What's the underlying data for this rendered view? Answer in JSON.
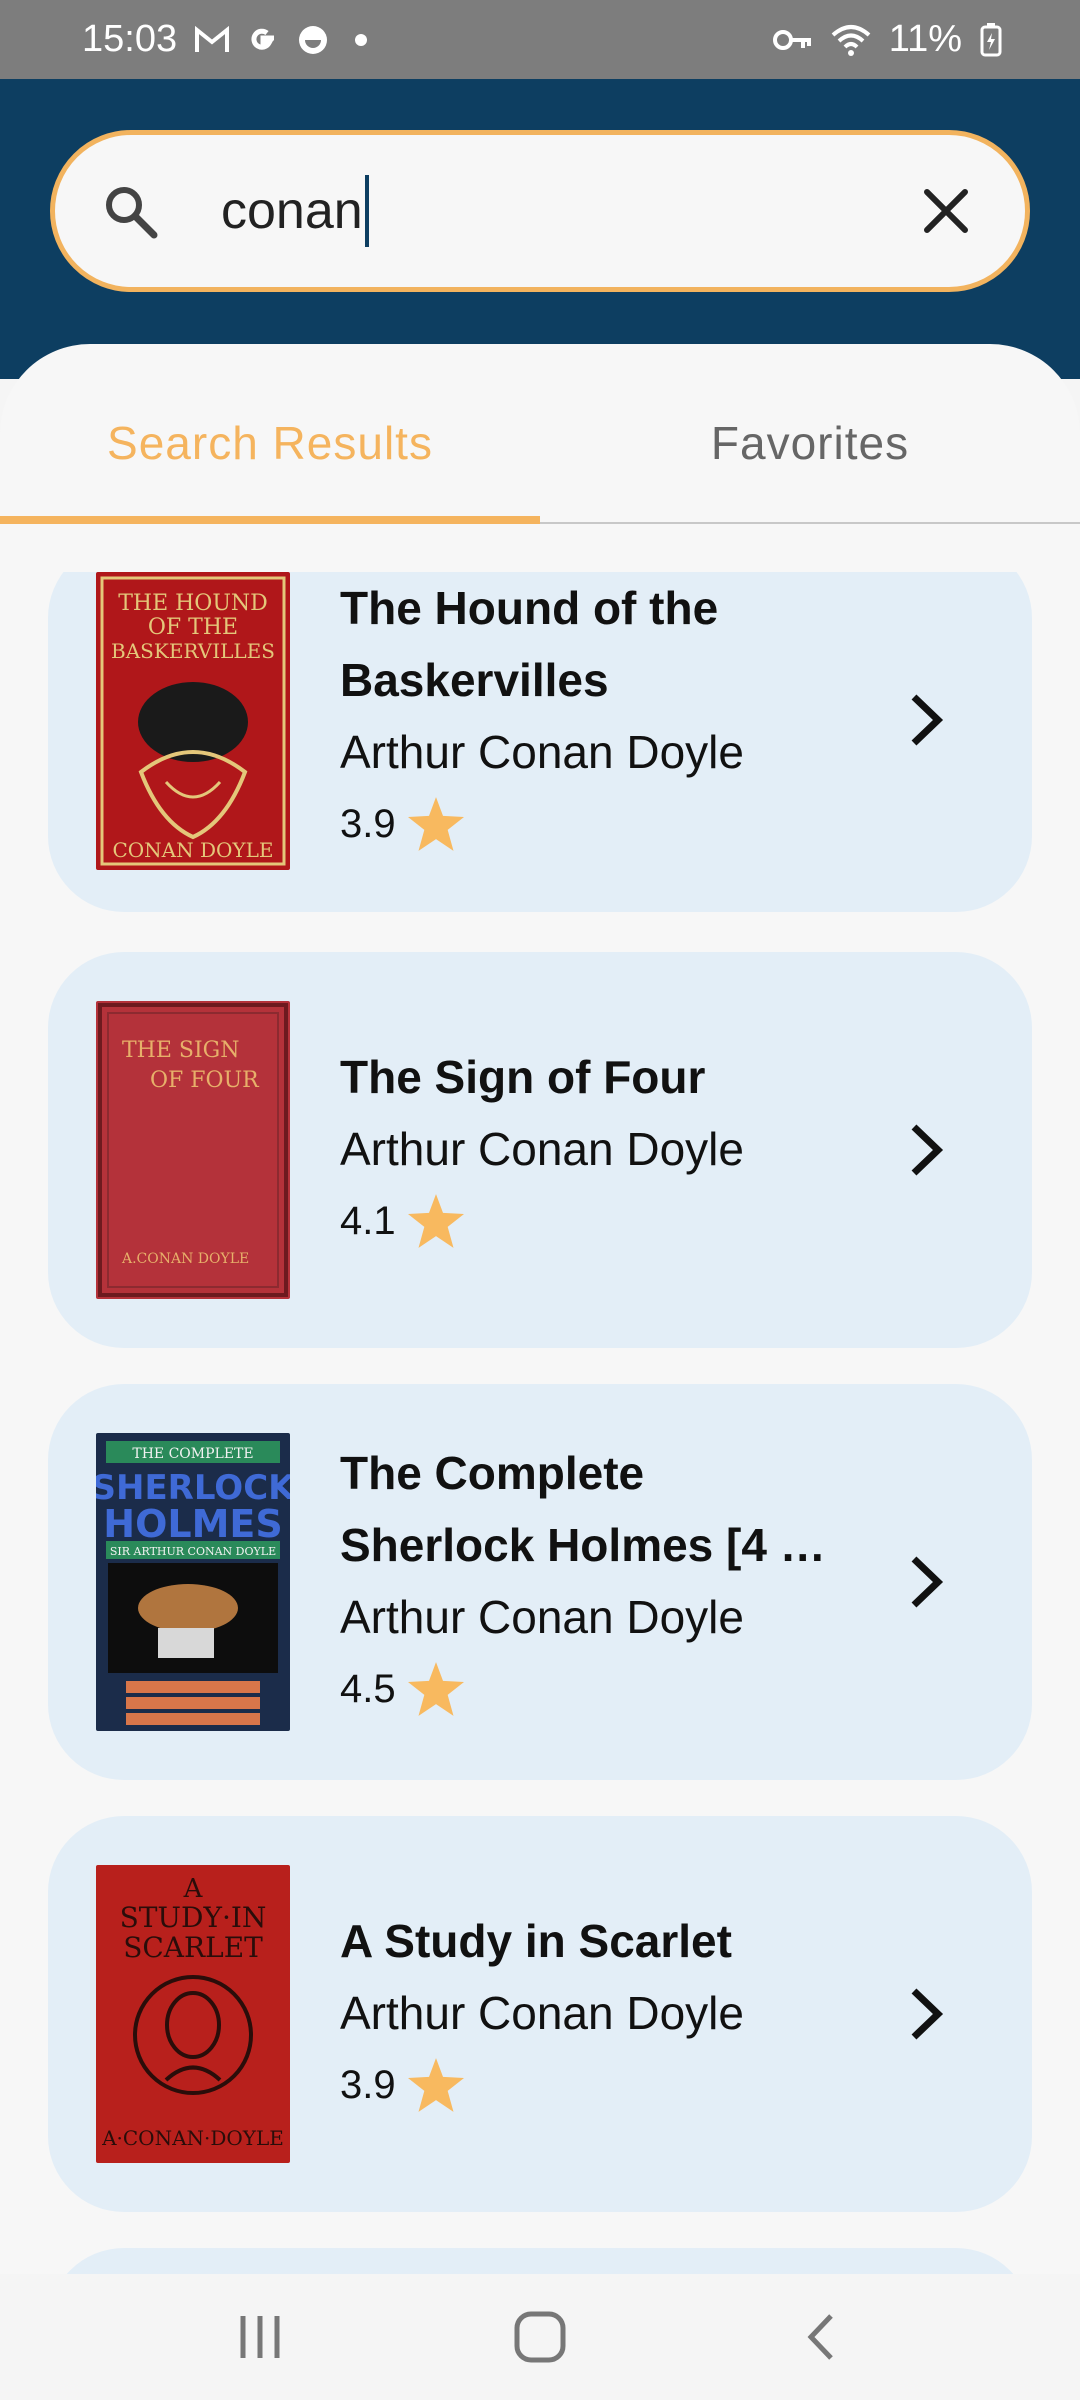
{
  "status_bar": {
    "time": "15:03",
    "battery": "11%",
    "icons": [
      "gmail-icon",
      "google-icon",
      "app-icon",
      "dot-icon",
      "vpn-key-icon",
      "wifi-icon",
      "battery-icon"
    ]
  },
  "search": {
    "value": "conan",
    "clear_icon": "close-icon",
    "search_icon": "search-icon"
  },
  "tabs": [
    {
      "label": "Search Results",
      "active": true
    },
    {
      "label": "Favorites",
      "active": false
    }
  ],
  "results": [
    {
      "title_line1": "The Hound of the",
      "title_line2": "Baskervilles",
      "author": "Arthur Conan Doyle",
      "rating": "3.9",
      "cover_text_top": "THE HOUND OF THE BASKERVILLES",
      "cover_text_bottom": "CONAN DOYLE"
    },
    {
      "title_line1": "The Sign of Four",
      "title_line2": "",
      "author": "Arthur Conan Doyle",
      "rating": "4.1",
      "cover_text_top": "THE SIGN OF FOUR",
      "cover_text_bottom": "A.CONAN DOYLE"
    },
    {
      "title_line1": "The Complete",
      "title_line2": "Sherlock Holmes [4 …",
      "author": "Arthur Conan Doyle",
      "rating": "4.5",
      "cover_text_top": "SHERLOCK HOLMES",
      "cover_text_bottom": "SIR ARTHUR CONAN DOYLE"
    },
    {
      "title_line1": "A Study in Scarlet",
      "title_line2": "",
      "author": "Arthur Conan Doyle",
      "rating": "3.9",
      "cover_text_top": "A STUDY IN SCARLET",
      "cover_text_bottom": "A.CONAN.DOYLE"
    }
  ],
  "colors": {
    "header": "#0d3e61",
    "accent": "#f5b45e",
    "card": "#e3eef7",
    "star": "#f8b95f"
  },
  "nav": [
    "recent-apps-icon",
    "home-icon",
    "back-icon"
  ]
}
